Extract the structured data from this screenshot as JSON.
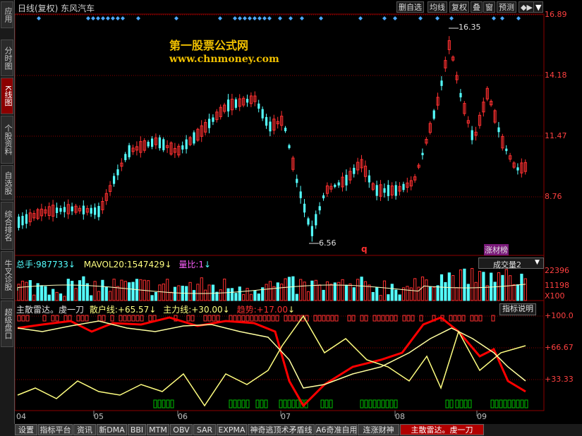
{
  "sidebar": [
    {
      "label": "应用",
      "active": false
    },
    {
      "label": "分时图",
      "active": false
    },
    {
      "label": "K线图",
      "active": true
    },
    {
      "label": "个股资料",
      "active": false
    },
    {
      "label": "自选股",
      "active": false
    },
    {
      "label": "综合排名",
      "active": false
    },
    {
      "label": "牛叉诊股",
      "active": false
    },
    {
      "label": "超级盘口",
      "active": false
    }
  ],
  "header": {
    "stock_title": "日线(复权)  东风汽车",
    "buttons": [
      "删自选",
      "均线",
      "复权",
      "叠",
      "窗",
      "预测"
    ],
    "nav_arrow": "◆▶",
    "menu_arrow": "▼"
  },
  "watermark": {
    "title": "第一股票公式网",
    "url": "www.chnmoney.com"
  },
  "price_axis": [
    "16.89",
    "14.18",
    "11.47",
    "8.76"
  ],
  "annotations": {
    "high": "16.35",
    "low": "6.56",
    "q_mark": "q",
    "badge": "涨材榜"
  },
  "volume_panel": {
    "legend_total_label": "总手:",
    "legend_total_value": "987733",
    "legend_mavol_label": "MAVOL20:",
    "legend_mavol_value": "1547429",
    "legend_ratio_label": "量比:",
    "legend_ratio_value": "1",
    "indicator_select": "成交量2",
    "axis": [
      "22396",
      "11198",
      "X100"
    ]
  },
  "indicator_panel": {
    "name": "主散雷达。虔一刀",
    "retail_label": "散户线:",
    "retail_value": "+65.57",
    "main_label": "主力线:",
    "main_value": "+30.00",
    "trend_label": "趋势:",
    "trend_value": "+17.00",
    "help_button": "指标说明",
    "axis": [
      "+100.0",
      "+66.67",
      "+33.33"
    ]
  },
  "dates": [
    "04",
    "05",
    "06",
    "07",
    "08",
    "09"
  ],
  "tabs": [
    "设置",
    "指标平台",
    "资讯",
    "新DMA",
    "BBI",
    "MTM",
    "OBV",
    "SAR",
    "EXPMA",
    "神奇逃顶术矛盾线",
    "A6奇准自用",
    "连涨财神",
    "主散雷达。虔一刀"
  ],
  "colors": {
    "up": "#ff3030",
    "down": "#54ffff",
    "ma": "#ffff80",
    "trend": "#ff0000",
    "green": "#00c000",
    "grid": "#8b0000"
  }
}
